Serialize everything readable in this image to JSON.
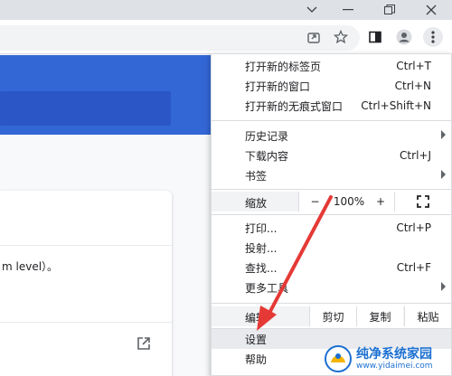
{
  "menu": {
    "new_tab": {
      "label": "打开新的标签页",
      "shortcut": "Ctrl+T"
    },
    "new_window": {
      "label": "打开新的窗口",
      "shortcut": "Ctrl+N"
    },
    "incognito": {
      "label": "打开新的无痕式窗口",
      "shortcut": "Ctrl+Shift+N"
    },
    "history": {
      "label": "历史记录"
    },
    "downloads": {
      "label": "下载内容",
      "shortcut": "Ctrl+J"
    },
    "bookmarks": {
      "label": "书签"
    },
    "zoom": {
      "label": "缩放",
      "minus": "−",
      "value": "100%",
      "plus": "+"
    },
    "print": {
      "label": "打印...",
      "shortcut": "Ctrl+P"
    },
    "cast": {
      "label": "投射..."
    },
    "find": {
      "label": "查找...",
      "shortcut": "Ctrl+F"
    },
    "more_tools": {
      "label": "更多工具"
    },
    "edit": {
      "label": "编辑",
      "cut": "剪切",
      "copy": "复制",
      "paste": "粘贴"
    },
    "settings": {
      "label": "设置"
    },
    "help": {
      "label": "帮助"
    }
  },
  "page": {
    "card_text": "m level）。"
  },
  "watermark": {
    "title": "纯净系统家园",
    "url": "www.yidaimei.com"
  },
  "colors": {
    "accent_blue": "#3367d6",
    "arrow_red": "#e53935"
  }
}
